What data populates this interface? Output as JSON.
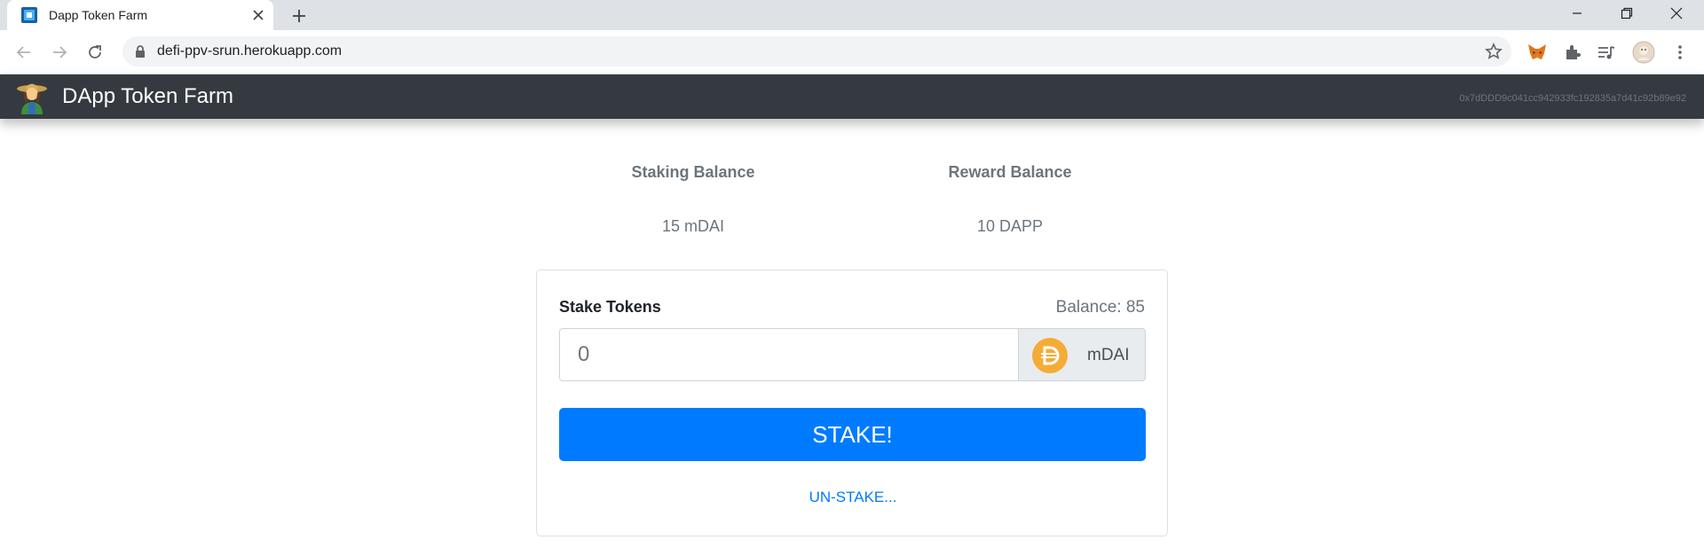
{
  "browser": {
    "tab_title": "Dapp Token Farm",
    "url": "defi-ppv-srun.herokuapp.com",
    "icons": {
      "favicon": "app-favicon-icon",
      "close": "close-icon",
      "new_tab": "plus-icon",
      "minimize": "minimize-icon",
      "restore": "restore-icon",
      "window_close": "window-close-icon",
      "back": "arrow-left-icon",
      "forward": "arrow-right-icon",
      "reload": "reload-icon",
      "lock": "lock-icon",
      "bookmark": "star-icon",
      "metamask": "metamask-fox-icon",
      "extensions": "puzzle-icon",
      "media": "media-queue-icon",
      "profile": "profile-avatar",
      "menu": "kebab-menu-icon"
    }
  },
  "app": {
    "brand": "DApp Token Farm",
    "account": "0x7dDDD9c041cc942933fc192835a7d41c92b89e92",
    "staking": {
      "heading": "Staking Balance",
      "value": "15 mDAI"
    },
    "reward": {
      "heading": "Reward Balance",
      "value": "10 DAPP"
    },
    "stake_card": {
      "label": "Stake Tokens",
      "balance": "Balance: 85",
      "input_placeholder": "0",
      "token": "mDAI",
      "stake_button": "STAKE!",
      "unstake_link": "UN-STAKE..."
    },
    "colors": {
      "navbar": "#343a40",
      "primary": "#007bff",
      "dai": "#f5ac37"
    }
  }
}
